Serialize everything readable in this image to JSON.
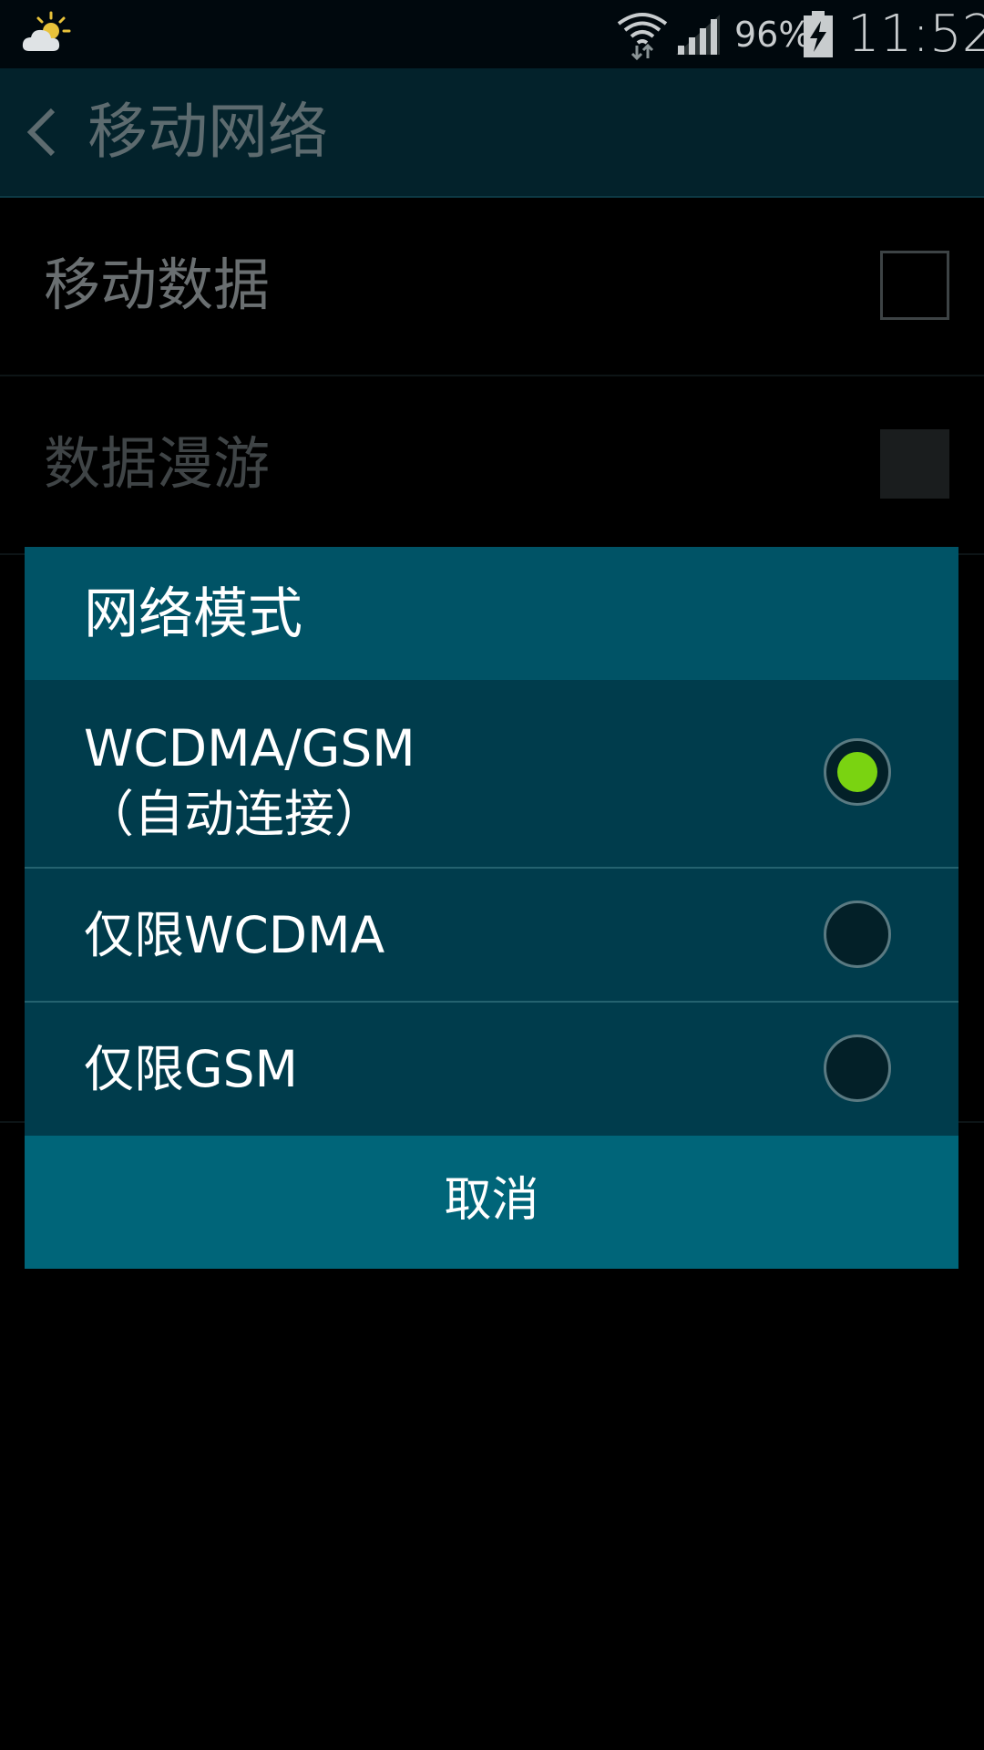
{
  "status_bar": {
    "weather_icon": "partly-cloudy-icon",
    "wifi_icon": "wifi-data-icon",
    "signal_icon": "cell-signal-icon",
    "battery_percent": "96%",
    "battery_icon": "battery-charging-icon",
    "time": "11:52"
  },
  "header": {
    "back_icon": "chevron-left-icon",
    "title": "移动网络"
  },
  "settings": {
    "items": [
      {
        "label": "移动数据",
        "checked": false,
        "enabled": true
      },
      {
        "label": "数据漫游",
        "checked": false,
        "enabled": false
      }
    ]
  },
  "dialog": {
    "title": "网络模式",
    "options": [
      {
        "line1": "WCDMA/GSM",
        "line2": "（自动连接）",
        "selected": true
      },
      {
        "label": "仅限WCDMA",
        "selected": false
      },
      {
        "label": "仅限GSM",
        "selected": false
      }
    ],
    "cancel_label": "取消"
  },
  "colors": {
    "dialog_title_bg": "#005366",
    "dialog_body_bg": "#003c4c",
    "dialog_button_bg": "#006579",
    "radio_selected": "#7ad311"
  }
}
